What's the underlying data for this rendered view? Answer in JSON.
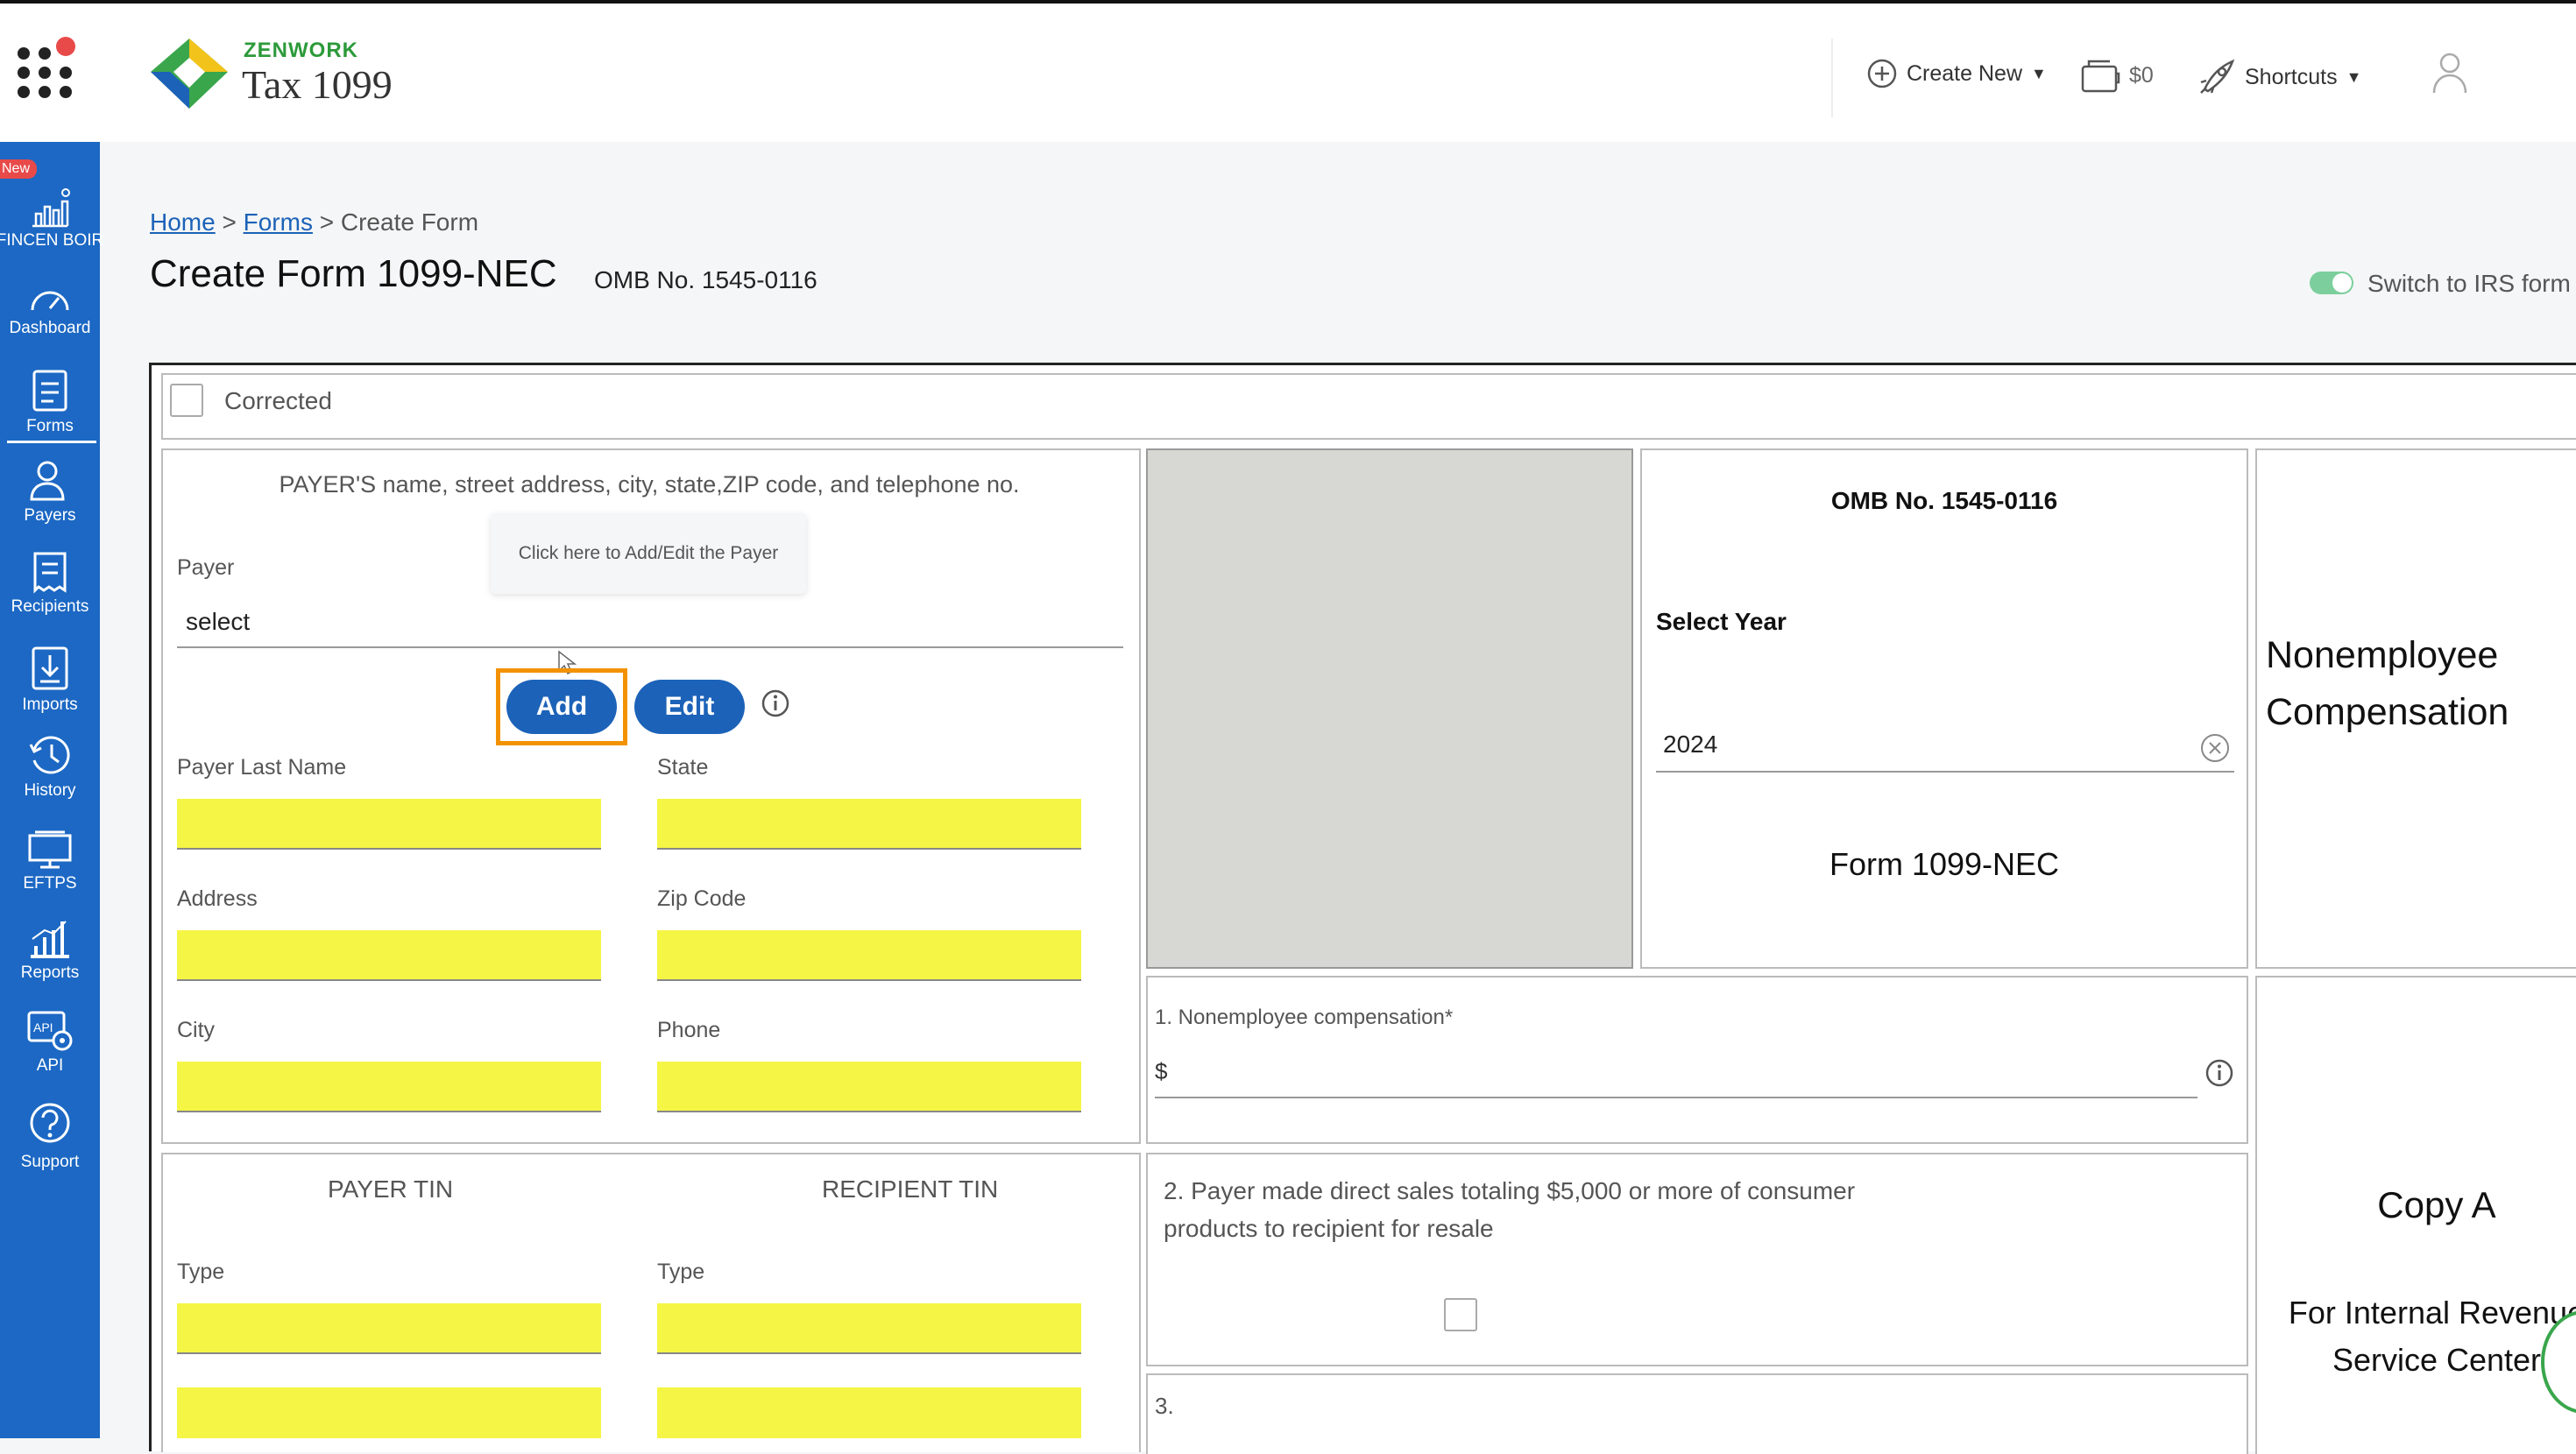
{
  "header": {
    "brand_top": "ZENWORK",
    "brand_main": "Tax 1099",
    "create_new": "Create New",
    "cart_amount": "$0",
    "shortcuts": "Shortcuts"
  },
  "sidebar": {
    "badge": "New",
    "items": [
      {
        "label": "FINCEN BOIR",
        "icon": "chart-icon"
      },
      {
        "label": "Dashboard",
        "icon": "gauge-icon"
      },
      {
        "label": "Forms",
        "icon": "document-icon"
      },
      {
        "label": "Payers",
        "icon": "user-icon"
      },
      {
        "label": "Recipients",
        "icon": "receipt-icon"
      },
      {
        "label": "Imports",
        "icon": "download-icon"
      },
      {
        "label": "History",
        "icon": "clock-icon"
      },
      {
        "label": "EFTPS",
        "icon": "monitor-icon"
      },
      {
        "label": "Reports",
        "icon": "bar-chart-icon"
      },
      {
        "label": "API",
        "icon": "api-icon"
      },
      {
        "label": "Support",
        "icon": "question-icon"
      }
    ]
  },
  "breadcrumb": {
    "home": "Home",
    "sep1": ">",
    "forms": "Forms",
    "sep2": ">",
    "current": "Create Form"
  },
  "page": {
    "title": "Create Form 1099-NEC",
    "omb": "OMB No. 1545-0116",
    "switch_label": "Switch to IRS form"
  },
  "form": {
    "corrected": "Corrected",
    "payer_heading": "PAYER'S name, street address, city, state,ZIP code, and telephone no.",
    "tooltip": "Click here to Add/Edit the Payer",
    "payer_label": "Payer",
    "payer_value": "select",
    "add_button": "Add",
    "edit_button": "Edit",
    "payer_last_name": "Payer Last Name",
    "state": "State",
    "address": "Address",
    "zip": "Zip Code",
    "city": "City",
    "phone": "Phone",
    "payer_tin": "PAYER TIN",
    "recipient_tin": "RECIPIENT TIN",
    "type_left": "Type",
    "type_right": "Type",
    "omb": "OMB No. 1545-0116",
    "select_year": "Select Year",
    "year_value": "2024",
    "form_name": "Form 1099-NEC",
    "nonemployee_title": "Nonemployee Compensation",
    "box1_label": "1. Nonemployee compensation*",
    "box1_currency": "$",
    "box2_label": "2. Payer made direct sales totaling $5,000 or more of consumer products to recipient for resale",
    "box3_label": "3.",
    "copy": "Copy A",
    "copy_sub": "For Internal Revenue Service Center"
  },
  "colors": {
    "sidebar": "#1c68c4",
    "button": "#1c62b8",
    "highlight": "#f39200",
    "field_yellow": "#f5f545"
  }
}
